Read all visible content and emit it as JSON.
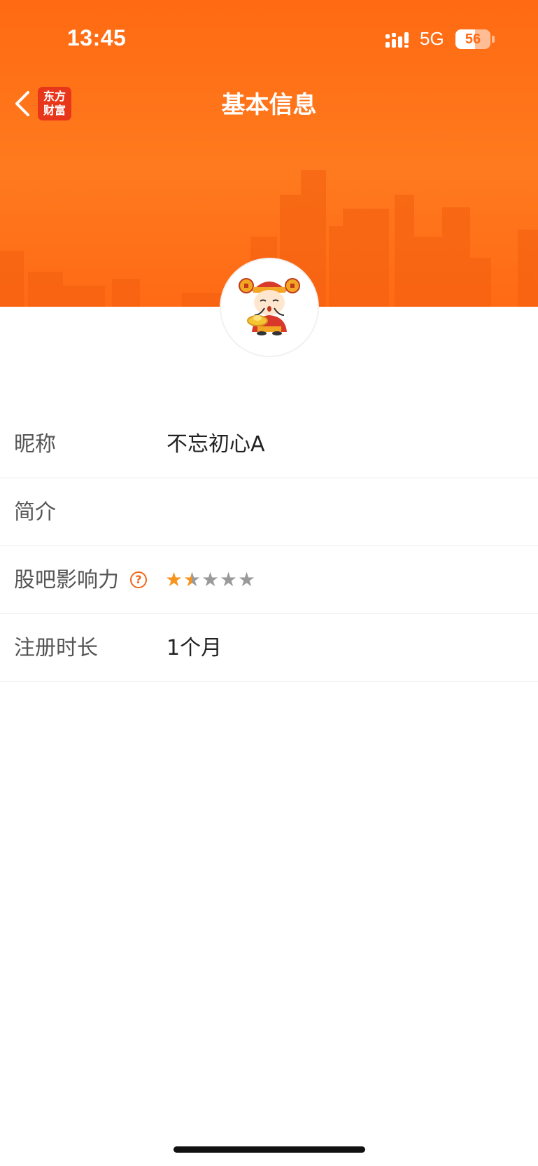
{
  "status_bar": {
    "time": "13:45",
    "network": "5G",
    "battery": "56"
  },
  "nav": {
    "title": "基本信息",
    "logo_line1": "东方",
    "logo_line2": "财富"
  },
  "profile": {
    "rows": [
      {
        "label": "昵称",
        "value": "不忘初心A"
      },
      {
        "label": "简介",
        "value": ""
      },
      {
        "label": "股吧影响力",
        "value": "",
        "rating": 1.5,
        "rating_max": 5
      },
      {
        "label": "注册时长",
        "value": "1个月"
      }
    ],
    "help_glyph": "?"
  },
  "colors": {
    "brand_orange": "#ff6a12",
    "star_active": "#f5941f",
    "star_inactive": "#9a9a9a",
    "logo_red": "#e8361a"
  },
  "icons": [
    "back-chevron-icon",
    "app-logo-icon",
    "signal-icon",
    "battery-icon",
    "help-icon",
    "star-icon"
  ]
}
